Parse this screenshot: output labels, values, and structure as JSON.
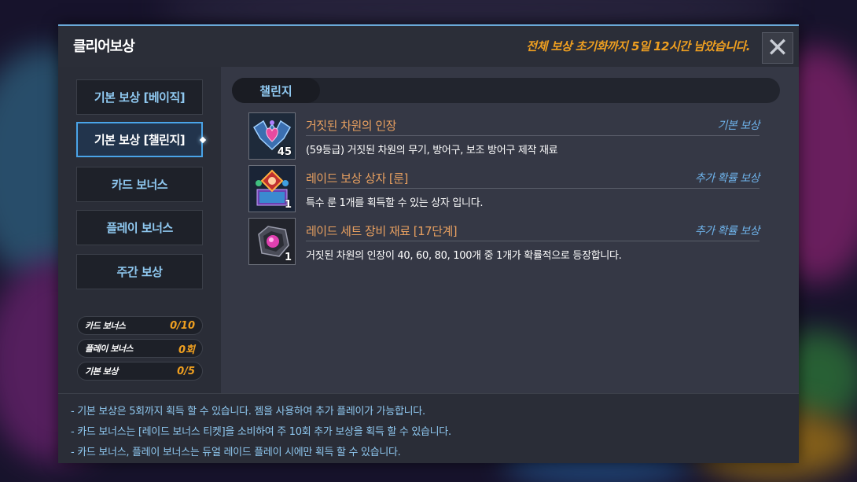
{
  "dialog": {
    "title": "클리어보상",
    "reset_notice": "전체 보상 초기화까지 5일 12시간 남았습니다.",
    "close_label": "✕"
  },
  "sidebar": {
    "menu": [
      {
        "label": "기본 보상 [베이직]",
        "active": false
      },
      {
        "label": "기본 보상 [챌린지]",
        "active": true
      },
      {
        "label": "카드 보너스",
        "active": false
      },
      {
        "label": "플레이 보너스",
        "active": false
      },
      {
        "label": "주간 보상",
        "active": false
      }
    ],
    "stats": [
      {
        "label": "카드 보너스",
        "value": "0/10"
      },
      {
        "label": "플레이 보너스",
        "value": "0회"
      },
      {
        "label": "기본 보상",
        "value": "0/5"
      }
    ]
  },
  "content": {
    "tab": "챌린지",
    "rewards": [
      {
        "name": "거짓된 차원의 인장",
        "type": "기본 보상",
        "qty": "45",
        "icon": "emblem-heart-icon",
        "desc": "(59등급) 거짓된 차원의 무기, 방어구, 보조 방어구 제작 재료"
      },
      {
        "name": "레이드 보상 상자 [룬]",
        "type": "추가 확률 보상",
        "qty": "1",
        "icon": "rune-box-icon",
        "desc": "특수 룬 1개를 획득할 수 있는 상자 입니다."
      },
      {
        "name": "레이드 세트 장비 재료 [17단계]",
        "type": "추가 확률 보상",
        "qty": "1",
        "icon": "gem-core-icon",
        "desc": "거짓된 차원의 인장이 40, 60, 80, 100개 중 1개가 확률적으로 등장합니다."
      }
    ]
  },
  "notes": [
    "- 기본 보상은 5회까지 획득 할 수 있습니다. 젬을 사용하여 추가 플레이가 가능합니다.",
    "- 카드 보너스는 [레이드 보너스 티켓]을 소비하여 주 10회 추가 보상을 획득 할 수 있습니다.",
    "- 카드 보너스, 플레이 보너스는 듀얼 레이드 플레이 시에만 획득 할 수 있습니다."
  ],
  "colors": {
    "accent_orange": "#f0a020",
    "accent_blue": "#6fb4ec",
    "item_name": "#e8a060"
  }
}
